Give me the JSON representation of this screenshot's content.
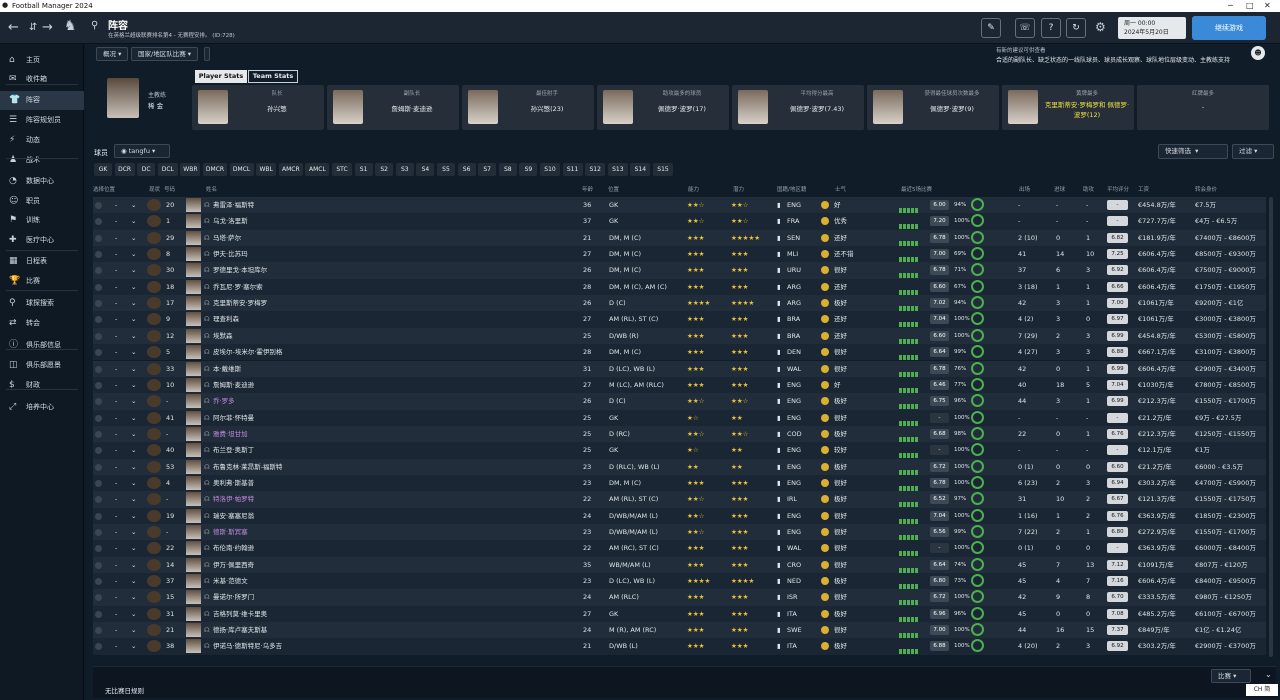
{
  "window": {
    "title": "Football Manager 2024"
  },
  "header": {
    "page_title": "阵容",
    "subtitle": "在英格兰超级联赛排名第4 - 无赛程安排。 (ID:728)",
    "date_line1": "周一 00:00",
    "date_line2": "2024年5月20日",
    "continue_label": "继续游戏"
  },
  "sidebar": {
    "items": [
      {
        "label": "主页",
        "icon": "home-icon"
      },
      {
        "label": "收件箱",
        "icon": "inbox-icon"
      },
      {
        "label": "阵容",
        "icon": "shirt-icon"
      },
      {
        "label": "阵容规划员",
        "icon": "planner-icon"
      },
      {
        "label": "动态",
        "icon": "dynamics-icon"
      },
      {
        "label": "战术",
        "icon": "tactics-icon"
      },
      {
        "label": "数据中心",
        "icon": "data-icon"
      },
      {
        "label": "职员",
        "icon": "staff-icon"
      },
      {
        "label": "训练",
        "icon": "training-icon"
      },
      {
        "label": "医疗中心",
        "icon": "medical-icon"
      },
      {
        "label": "日程表",
        "icon": "calendar-icon"
      },
      {
        "label": "比赛",
        "icon": "trophy-icon"
      },
      {
        "label": "球探搜索",
        "icon": "scout-icon"
      },
      {
        "label": "转会",
        "icon": "transfer-icon"
      },
      {
        "label": "俱乐部信息",
        "icon": "club-icon"
      },
      {
        "label": "俱乐部愿景",
        "icon": "vision-icon"
      },
      {
        "label": "财政",
        "icon": "finance-icon"
      },
      {
        "label": "培养中心",
        "icon": "development-icon"
      }
    ]
  },
  "subnav": {
    "overview": "概况",
    "national": "国家/地区队比赛"
  },
  "notice": {
    "title": "有新的建议可供查看",
    "text": "合适的副队长、缺乏状态的一线队球员、球员成长观察、球队地位层级变动、主教练支持"
  },
  "manager": {
    "role": "主教练",
    "name": "稀 金"
  },
  "tabs": {
    "player_stats": "Player Stats",
    "team_stats": "Team Stats"
  },
  "stat_cards": [
    {
      "label": "队长",
      "value": "孙兴慜"
    },
    {
      "label": "副队长",
      "value": "詹姆斯·麦迪逊"
    },
    {
      "label": "最佳射手",
      "value": "孙兴慜(23)"
    },
    {
      "label": "助攻最多的球员",
      "value": "佩德罗·波罗(17)"
    },
    {
      "label": "平均得分最高",
      "value": "佩德罗·波罗(7.43)"
    },
    {
      "label": "获得最佳球员次数最多",
      "value": "佩德罗·波罗(9)"
    },
    {
      "label": "黄牌最多",
      "value": "克里斯蒂安·罗梅罗和 佩德罗·波罗(12)"
    },
    {
      "label": "红牌最多",
      "value": "-"
    }
  ],
  "filter": {
    "label": "球员",
    "view": "tangfu",
    "quick": "快速筛选",
    "filter": "过滤"
  },
  "positions": [
    "GK",
    "DCR",
    "DC",
    "DCL",
    "WBR",
    "DMCR",
    "DMCL",
    "WBL",
    "AMCR",
    "AMCL",
    "STC",
    "S1",
    "S2",
    "S3",
    "S4",
    "S5",
    "S6",
    "S7",
    "S8",
    "S9",
    "S10",
    "S11",
    "S12",
    "S13",
    "S14",
    "S15"
  ],
  "columns": {
    "select": "选择位置",
    "status": "现状",
    "num": "号码",
    "name": "姓名",
    "age": "年龄",
    "pos": "位置",
    "ca": "能力",
    "pa": "潜力",
    "nat": "国籍/地区籍",
    "morale": "士气",
    "form": "最近5场比赛",
    "apps": "出场",
    "goals": "进球",
    "assists": "助攻",
    "avg": "平均评分",
    "wage": "工资",
    "value": "转会身价"
  },
  "players": [
    {
      "num": "20",
      "name": "弗雷泽·福斯特",
      "age": "36",
      "pos": "GK",
      "ca": "★★☆",
      "pa": "★★☆",
      "nat": "ENG",
      "morale": "好",
      "rating": "6.00",
      "fit": "94%",
      "apps": "-",
      "goals": "-",
      "assists": "-",
      "avg": "-",
      "wage": "€454.8万/年",
      "value": "€7.5万"
    },
    {
      "num": "1",
      "name": "乌戈·洛里斯",
      "age": "37",
      "pos": "GK",
      "ca": "★★☆",
      "pa": "★★☆",
      "nat": "FRA",
      "morale": "优秀",
      "rating": "7.20",
      "fit": "100%",
      "apps": "-",
      "goals": "-",
      "assists": "-",
      "avg": "-",
      "wage": "€727.7万/年",
      "value": "€4万 - €6.5万"
    },
    {
      "num": "29",
      "name": "马塔·萨尔",
      "age": "21",
      "pos": "DM, M (C)",
      "ca": "★★★",
      "pa": "★★★★★",
      "nat": "SEN",
      "morale": "还好",
      "rating": "6.78",
      "fit": "100%",
      "apps": "2 (10)",
      "goals": "0",
      "assists": "1",
      "avg": "6.82",
      "wage": "€181.9万/年",
      "value": "€7400万 - €8600万"
    },
    {
      "num": "8",
      "name": "伊夫·比苏玛",
      "age": "27",
      "pos": "DM, M (C)",
      "ca": "★★★",
      "pa": "★★★",
      "nat": "MLI",
      "morale": "还不错",
      "rating": "7.00",
      "fit": "69%",
      "apps": "41",
      "goals": "14",
      "assists": "10",
      "avg": "7.25",
      "wage": "€606.4万/年",
      "value": "€8500万 - €9300万"
    },
    {
      "num": "30",
      "name": "罗德里戈·本坦库尔",
      "age": "26",
      "pos": "DM, M (C)",
      "ca": "★★★",
      "pa": "★★★",
      "nat": "URU",
      "morale": "很好",
      "rating": "6.78",
      "fit": "71%",
      "apps": "37",
      "goals": "6",
      "assists": "3",
      "avg": "6.92",
      "wage": "€606.4万/年",
      "value": "€7500万 - €9000万"
    },
    {
      "num": "18",
      "name": "乔瓦尼·罗·塞尔索",
      "age": "28",
      "pos": "DM, M (C), AM (C)",
      "ca": "★★★",
      "pa": "★★★",
      "nat": "ARG",
      "morale": "还好",
      "rating": "6.60",
      "fit": "67%",
      "apps": "3 (18)",
      "goals": "1",
      "assists": "1",
      "avg": "6.66",
      "wage": "€606.4万/年",
      "value": "€1750万 - €1950万"
    },
    {
      "num": "17",
      "name": "克里斯蒂安·罗梅罗",
      "age": "26",
      "pos": "D (C)",
      "ca": "★★★★",
      "pa": "★★★★",
      "nat": "ARG",
      "morale": "极好",
      "rating": "7.02",
      "fit": "94%",
      "apps": "42",
      "goals": "3",
      "assists": "1",
      "avg": "7.00",
      "wage": "€1061万/年",
      "value": "€9200万 - €1亿"
    },
    {
      "num": "9",
      "name": "理查利森",
      "age": "27",
      "pos": "AM (RL), ST (C)",
      "ca": "★★★",
      "pa": "★★★",
      "nat": "BRA",
      "morale": "还好",
      "rating": "7.04",
      "fit": "100%",
      "apps": "4 (2)",
      "goals": "3",
      "assists": "0",
      "avg": "6.97",
      "wage": "€1061万/年",
      "value": "€3000万 - €3800万"
    },
    {
      "num": "12",
      "name": "埃默森",
      "age": "25",
      "pos": "D/WB (R)",
      "ca": "★★★",
      "pa": "★★★",
      "nat": "BRA",
      "morale": "还好",
      "rating": "6.60",
      "fit": "100%",
      "apps": "7 (29)",
      "goals": "2",
      "assists": "3",
      "avg": "6.99",
      "wage": "€454.8万/年",
      "value": "€5300万 - €5800万"
    },
    {
      "num": "5",
      "name": "皮埃尔-埃米尔·霍伊别格",
      "age": "28",
      "pos": "DM, M (C)",
      "ca": "★★★",
      "pa": "★★★",
      "nat": "DEN",
      "morale": "很好",
      "rating": "6.64",
      "fit": "99%",
      "apps": "4 (27)",
      "goals": "3",
      "assists": "3",
      "avg": "6.88",
      "wage": "€667.1万/年",
      "value": "€3100万 - €3800万"
    },
    {
      "num": "33",
      "name": "本·戴维斯",
      "age": "31",
      "pos": "D (LC), WB (L)",
      "ca": "★★★",
      "pa": "★★★",
      "nat": "WAL",
      "morale": "很好",
      "rating": "6.78",
      "fit": "76%",
      "apps": "42",
      "goals": "0",
      "assists": "1",
      "avg": "6.99",
      "wage": "€606.4万/年",
      "value": "€2900万 - €3400万"
    },
    {
      "num": "10",
      "name": "詹姆斯·麦迪逊",
      "age": "27",
      "pos": "M (LC), AM (RLC)",
      "ca": "★★★",
      "pa": "★★★",
      "nat": "ENG",
      "morale": "好",
      "rating": "6.46",
      "fit": "77%",
      "apps": "40",
      "goals": "18",
      "assists": "5",
      "avg": "7.04",
      "wage": "€1030万/年",
      "value": "€7800万 - €8500万"
    },
    {
      "num": "-",
      "name": "乔·罗多",
      "age": "26",
      "pos": "D (C)",
      "ca": "★★☆",
      "pa": "★★☆",
      "nat": "ENG",
      "morale": "极好",
      "rating": "6.75",
      "fit": "96%",
      "apps": "44",
      "goals": "3",
      "assists": "1",
      "avg": "6.99",
      "wage": "€212.3万/年",
      "value": "€1550万 - €1700万"
    },
    {
      "num": "41",
      "name": "阿尔菲·怀特曼",
      "age": "25",
      "pos": "GK",
      "ca": "★☆",
      "pa": "★★",
      "nat": "ENG",
      "morale": "很好",
      "rating": "-",
      "fit": "100%",
      "apps": "-",
      "goals": "-",
      "assists": "-",
      "avg": "-",
      "wage": "€21.2万/年",
      "value": "€9万 - €27.5万"
    },
    {
      "num": "-",
      "name": "雅费·坦甘加",
      "age": "25",
      "pos": "D (RC)",
      "ca": "★★☆",
      "pa": "★★☆",
      "nat": "COD",
      "morale": "极好",
      "rating": "6.68",
      "fit": "98%",
      "apps": "22",
      "goals": "0",
      "assists": "1",
      "avg": "6.76",
      "wage": "€212.3万/年",
      "value": "€1250万 - €1550万"
    },
    {
      "num": "40",
      "name": "布兰登·奥斯丁",
      "age": "25",
      "pos": "GK",
      "ca": "★☆",
      "pa": "★★",
      "nat": "ENG",
      "morale": "较好",
      "rating": "-",
      "fit": "100%",
      "apps": "-",
      "goals": "-",
      "assists": "-",
      "avg": "-",
      "wage": "€12.1万/年",
      "value": "€1万"
    },
    {
      "num": "53",
      "name": "布鲁克林·莱昂斯-福斯特",
      "age": "23",
      "pos": "D (RLC), WB (L)",
      "ca": "★★",
      "pa": "★★",
      "nat": "ENG",
      "morale": "极好",
      "rating": "6.72",
      "fit": "100%",
      "apps": "0 (1)",
      "goals": "0",
      "assists": "0",
      "avg": "6.60",
      "wage": "€21.2万/年",
      "value": "€6000 - €3.5万"
    },
    {
      "num": "4",
      "name": "奥利弗·斯基普",
      "age": "23",
      "pos": "DM, M (C)",
      "ca": "★★★",
      "pa": "★★★",
      "nat": "ENG",
      "morale": "很好",
      "rating": "6.78",
      "fit": "100%",
      "apps": "6 (23)",
      "goals": "2",
      "assists": "3",
      "avg": "6.94",
      "wage": "€303.2万/年",
      "value": "€4700万 - €5900万"
    },
    {
      "num": "-",
      "name": "特洛伊·帕罗特",
      "age": "22",
      "pos": "AM (RL), ST (C)",
      "ca": "★★☆",
      "pa": "★★★",
      "nat": "IRL",
      "morale": "极好",
      "rating": "6.52",
      "fit": "97%",
      "apps": "31",
      "goals": "10",
      "assists": "2",
      "avg": "6.67",
      "wage": "€121.3万/年",
      "value": "€1550万 - €1750万"
    },
    {
      "num": "19",
      "name": "瑞安·塞塞尼翁",
      "age": "24",
      "pos": "D/WB/M/AM (L)",
      "ca": "★★☆",
      "pa": "★★★",
      "nat": "ENG",
      "morale": "很好",
      "rating": "7.04",
      "fit": "100%",
      "apps": "1 (16)",
      "goals": "1",
      "assists": "2",
      "avg": "6.76",
      "wage": "€363.9万/年",
      "value": "€1850万 - €2300万"
    },
    {
      "num": "-",
      "name": "德斯·斯宾塞",
      "age": "23",
      "pos": "D/WB/M/AM (L)",
      "ca": "★★☆",
      "pa": "★★★",
      "nat": "ENG",
      "morale": "很好",
      "rating": "6.56",
      "fit": "99%",
      "apps": "7 (22)",
      "goals": "2",
      "assists": "1",
      "avg": "6.80",
      "wage": "€272.9万/年",
      "value": "€1550万 - €1700万"
    },
    {
      "num": "22",
      "name": "布伦南·约翰逊",
      "age": "22",
      "pos": "AM (RC), ST (C)",
      "ca": "★★★",
      "pa": "★★★",
      "nat": "WAL",
      "morale": "很好",
      "rating": "-",
      "fit": "100%",
      "apps": "0 (1)",
      "goals": "0",
      "assists": "0",
      "avg": "-",
      "wage": "€363.9万/年",
      "value": "€6000万 - €8400万"
    },
    {
      "num": "14",
      "name": "伊万·佩里西奇",
      "age": "35",
      "pos": "WB/M/AM (L)",
      "ca": "★★★",
      "pa": "★★★",
      "nat": "CRO",
      "morale": "很好",
      "rating": "6.64",
      "fit": "74%",
      "apps": "45",
      "goals": "7",
      "assists": "13",
      "avg": "7.12",
      "wage": "€1091万/年",
      "value": "€807万 - €120万"
    },
    {
      "num": "37",
      "name": "米基·范德文",
      "age": "23",
      "pos": "D (LC), WB (L)",
      "ca": "★★★★",
      "pa": "★★★★",
      "nat": "NED",
      "morale": "极好",
      "rating": "6.80",
      "fit": "73%",
      "apps": "45",
      "goals": "4",
      "assists": "7",
      "avg": "7.16",
      "wage": "€606.4万/年",
      "value": "€8400万 - €9500万"
    },
    {
      "num": "15",
      "name": "曼诺尔·所罗门",
      "age": "24",
      "pos": "AM (RLC)",
      "ca": "★★★",
      "pa": "★★★",
      "nat": "ISR",
      "morale": "很好",
      "rating": "6.72",
      "fit": "100%",
      "apps": "42",
      "goals": "9",
      "assists": "8",
      "avg": "6.70",
      "wage": "€333.5万/年",
      "value": "€980万 - €1250万"
    },
    {
      "num": "31",
      "name": "吉格列莫·维卡里奥",
      "age": "27",
      "pos": "GK",
      "ca": "★★★",
      "pa": "★★★",
      "nat": "ITA",
      "morale": "极好",
      "rating": "6.96",
      "fit": "96%",
      "apps": "45",
      "goals": "0",
      "assists": "0",
      "avg": "7.08",
      "wage": "€485.2万/年",
      "value": "€6100万 - €6700万"
    },
    {
      "num": "21",
      "name": "德扬·库卢塞夫斯基",
      "age": "24",
      "pos": "M (R), AM (RC)",
      "ca": "★★★",
      "pa": "★★★",
      "nat": "SWE",
      "morale": "很好",
      "rating": "7.00",
      "fit": "100%",
      "apps": "44",
      "goals": "16",
      "assists": "15",
      "avg": "7.37",
      "wage": "€849万/年",
      "value": "€1亿 - €1.24亿"
    },
    {
      "num": "38",
      "name": "伊诺马·德斯特尼·乌多吉",
      "age": "21",
      "pos": "D/WB (L)",
      "ca": "★★★",
      "pa": "★★★",
      "nat": "ITA",
      "morale": "极好",
      "rating": "6.88",
      "fit": "100%",
      "apps": "4 (20)",
      "goals": "2",
      "assists": "3",
      "avg": "6.92",
      "wage": "€303.2万/年",
      "value": "€2900万 - €3700万"
    }
  ],
  "footer": {
    "text": "无比赛日规则",
    "match_dd": "比赛",
    "ime": "CH 简"
  },
  "colors": {
    "accent": "#3b8ad9",
    "bg": "#101c28",
    "sidebar": "#0f1923",
    "good": "#4caf50"
  }
}
